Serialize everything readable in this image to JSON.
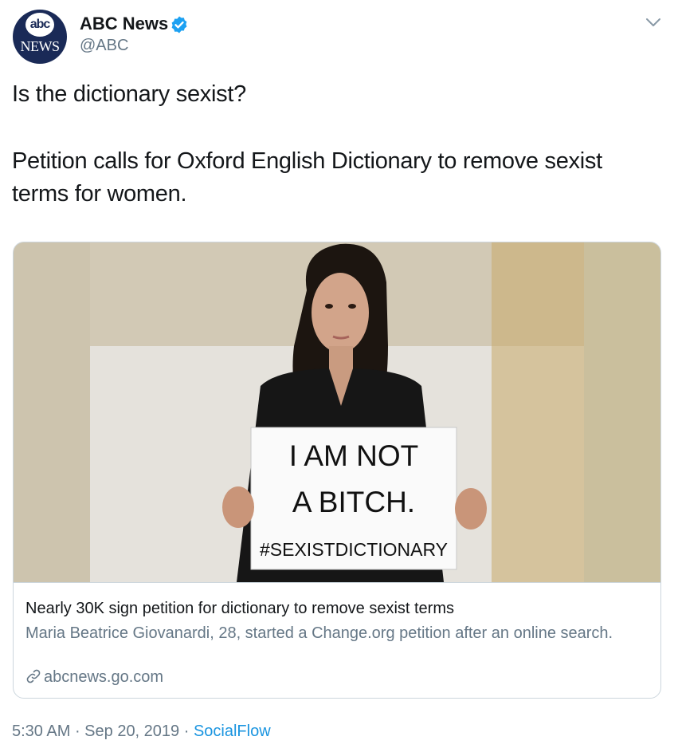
{
  "author": {
    "avatar_top": "abc",
    "avatar_bottom": "NEWS",
    "display_name": "ABC News",
    "handle": "@ABC",
    "verified": true
  },
  "tweet": {
    "line1": "Is the dictionary sexist?",
    "line2": "Petition calls for Oxford English Dictionary to remove sexist terms for women."
  },
  "card": {
    "sign_lines": [
      "I AM NOT",
      "A BITCH.",
      "#SEXISTDICTIONARY"
    ],
    "title": "Nearly 30K sign petition for dictionary to remove sexist terms",
    "description": "Maria Beatrice Giovanardi, 28, started a Change.org petition after an online search.",
    "domain": "abcnews.go.com"
  },
  "meta": {
    "time": "5:30 AM",
    "separator": " · ",
    "date": "Sep 20, 2019",
    "source": "SocialFlow"
  },
  "icons": [
    "verified-badge-icon",
    "chevron-down-icon",
    "link-icon"
  ],
  "colors": {
    "verified": "#1da1f2",
    "link": "#1b95e0",
    "secondary_text": "#657786",
    "abc_navy": "#1a2a57"
  }
}
